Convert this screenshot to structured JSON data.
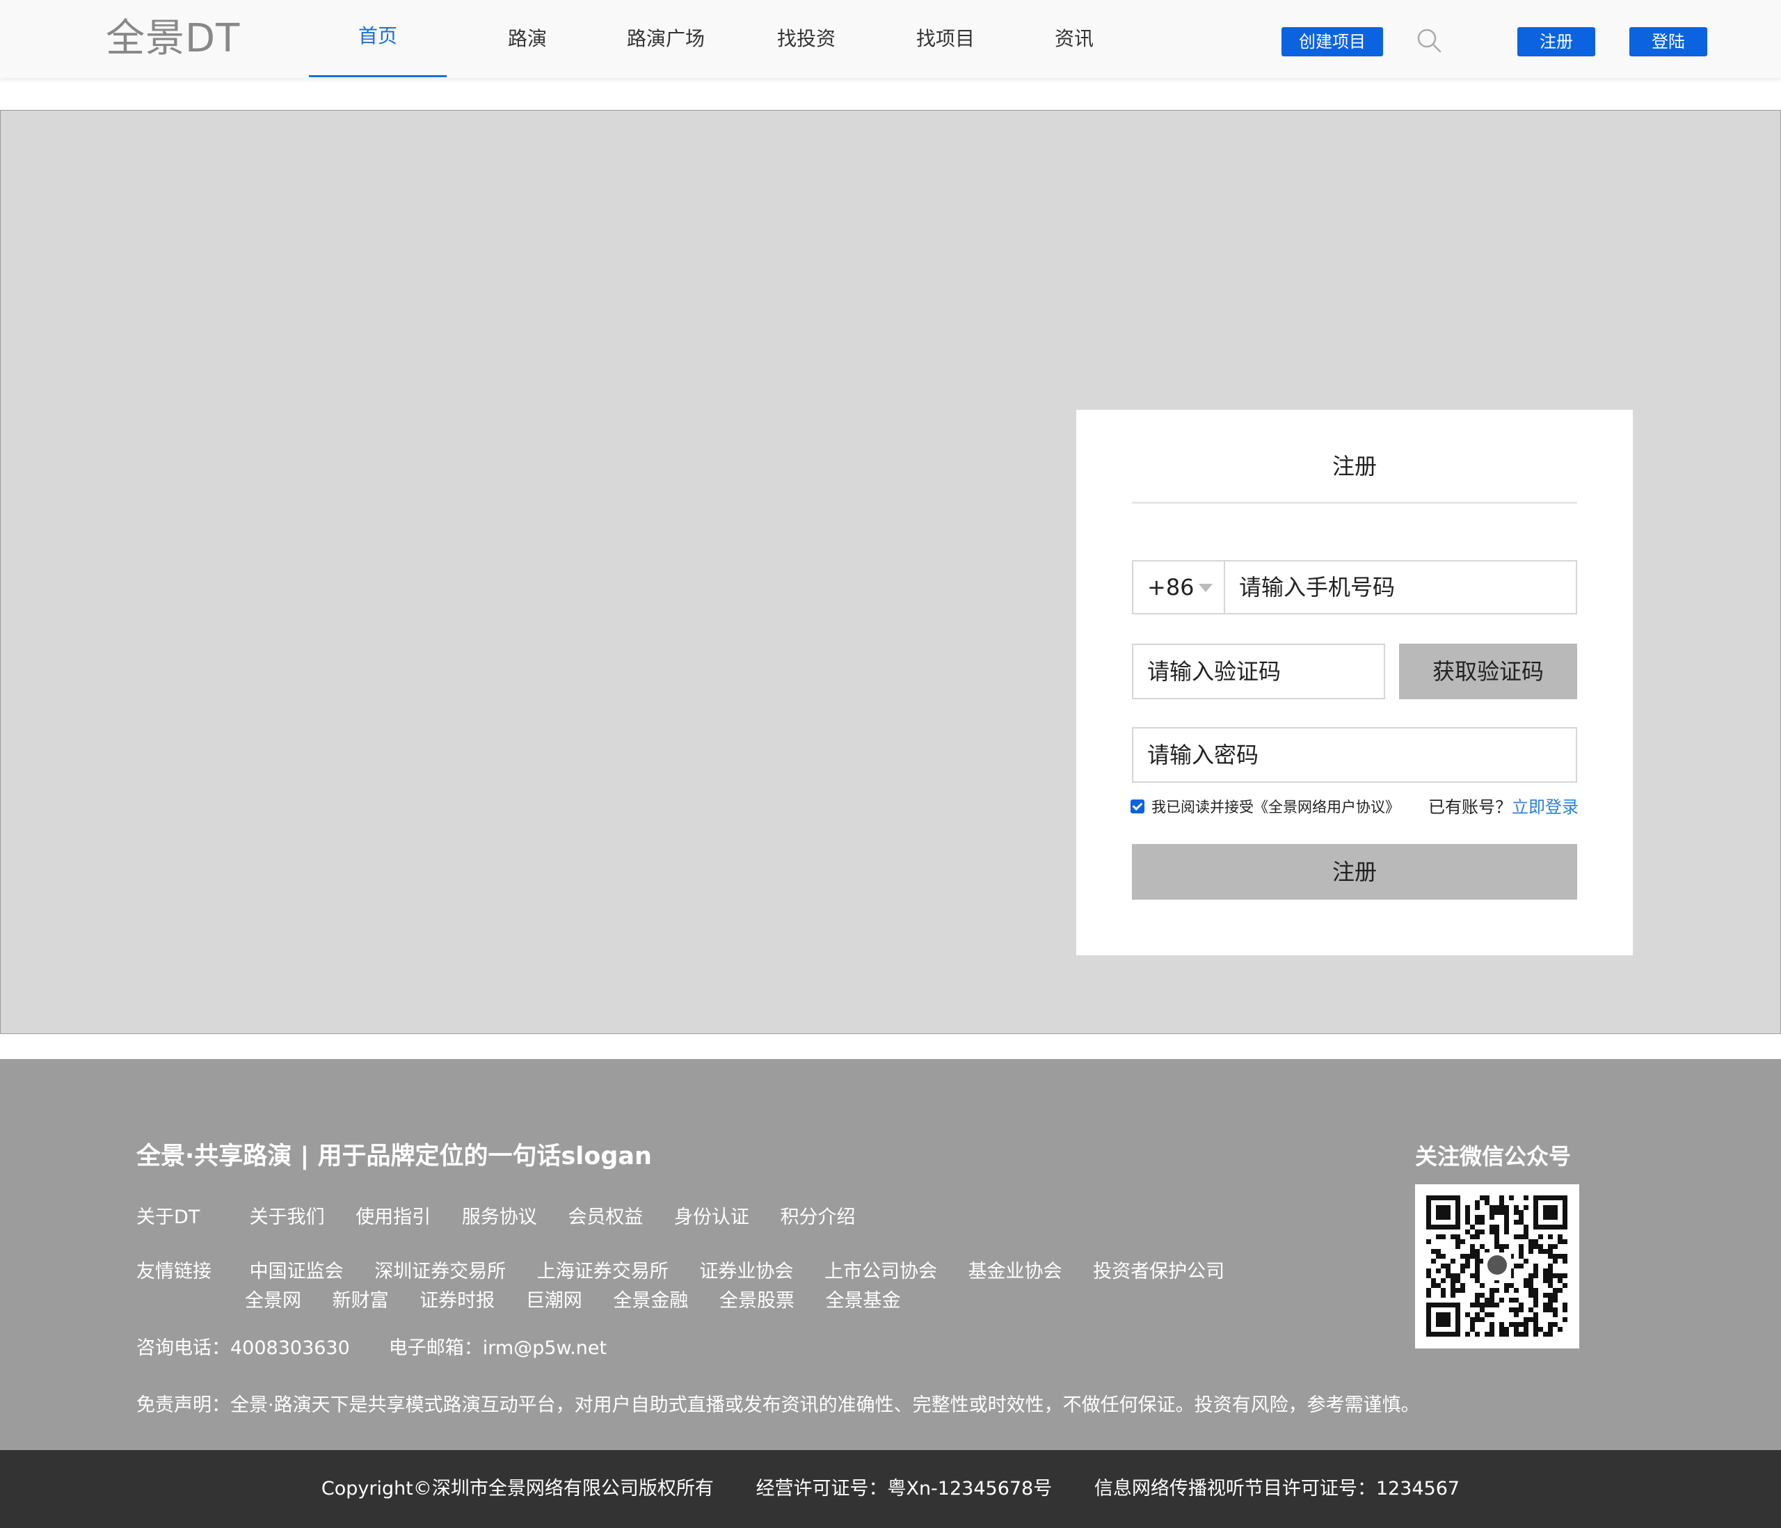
{
  "header": {
    "logo": "全景DT",
    "nav": [
      {
        "label": "首页",
        "active": true
      },
      {
        "label": "路演"
      },
      {
        "label": "路演广场"
      },
      {
        "label": "找投资"
      },
      {
        "label": "找项目"
      },
      {
        "label": "资讯"
      }
    ],
    "create_project": "创建项目",
    "register": "注册",
    "login": "登陆",
    "accent_color": "#0b63e0"
  },
  "register_form": {
    "title": "注册",
    "country_code": "+86",
    "phone_placeholder": "请输入手机号码",
    "code_placeholder": "请输入验证码",
    "get_code": "获取验证码",
    "password_placeholder": "请输入密码",
    "agreement": "我已阅读并接受《全景网络用户协议》",
    "agreement_checked": true,
    "has_account": "已有账号？",
    "login_now": "立即登录",
    "submit": "注册"
  },
  "footer": {
    "slogan": "全景·共享路演 | 用于品牌定位的一句话slogan",
    "about_label": "关于DT",
    "about_links": [
      "关于我们",
      "使用指引",
      "服务协议",
      "会员权益",
      "身份认证",
      "积分介绍"
    ],
    "friend_label": "友情链接",
    "friend_links_row1": [
      "中国证监会",
      "深圳证券交易所",
      "上海证券交易所",
      "证券业协会",
      "上市公司协会",
      "基金业协会",
      "投资者保护公司"
    ],
    "friend_links_row2": [
      "全景网",
      "新财富",
      "证券时报",
      "巨潮网",
      "全景金融",
      "全景股票",
      "全景基金"
    ],
    "phone_label": "咨询电话：",
    "phone": "4008303630",
    "email_label": "电子邮箱：",
    "email": "irm@p5w.net",
    "disclaimer_label": "免责声明：",
    "disclaimer": "全景·路演天下是共享模式路演互动平台，对用户自助式直播或发布资讯的准确性、完整性或时效性，不做任何保证。投资有风险，参考需谨慎。",
    "wechat_title": "关注微信公众号",
    "copyright": "Copyright©深圳市全景网络有限公司版权所有",
    "license": "经营许可证号：粤Xn-12345678号",
    "av_license": "信息网络传播视听节目许可证号：1234567"
  }
}
